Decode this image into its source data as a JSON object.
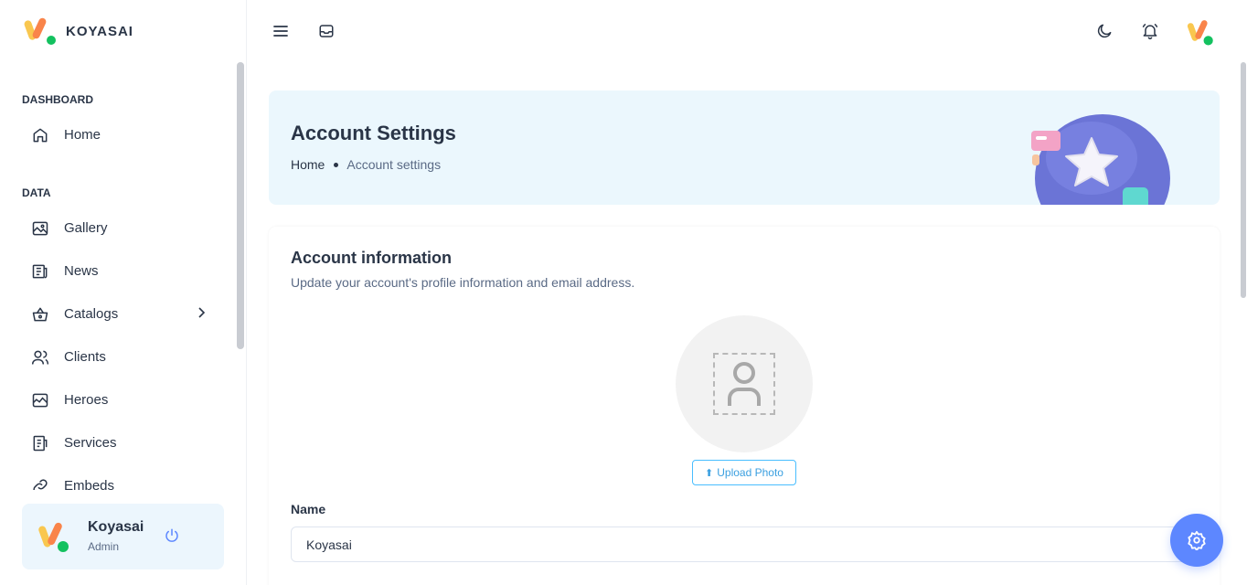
{
  "brand": {
    "name": "KOYASAI"
  },
  "nav": {
    "sections": [
      {
        "title": "DASHBOARD",
        "items": [
          {
            "label": "Home",
            "icon": "home-icon"
          }
        ]
      },
      {
        "title": "DATA",
        "items": [
          {
            "label": "Gallery",
            "icon": "gallery-icon"
          },
          {
            "label": "News",
            "icon": "news-icon"
          },
          {
            "label": "Catalogs",
            "icon": "basket-icon",
            "has_submenu": true
          },
          {
            "label": "Clients",
            "icon": "users-icon"
          },
          {
            "label": "Heroes",
            "icon": "image-icon"
          },
          {
            "label": "Services",
            "icon": "clipboard-icon"
          },
          {
            "label": "Embeds",
            "icon": "link-icon"
          }
        ]
      }
    ]
  },
  "user": {
    "name": "Koyasai",
    "role": "Admin"
  },
  "banner": {
    "title": "Account Settings",
    "breadcrumb": {
      "home": "Home",
      "current": "Account settings"
    }
  },
  "account": {
    "title": "Account information",
    "subtitle": "Update your account's profile information and email address.",
    "upload_label": "Upload Photo",
    "name_label": "Name",
    "name_value": "Koyasai"
  },
  "colors": {
    "accent": "#5d87ff",
    "banner_bg": "#ebf7fd",
    "upload_border": "#49beff"
  }
}
